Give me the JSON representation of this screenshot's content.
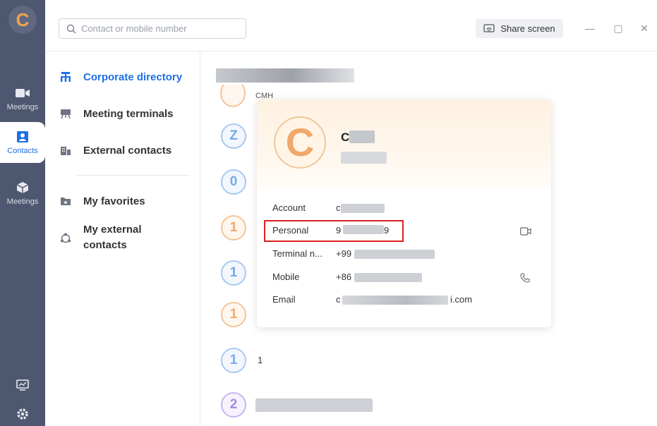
{
  "rail": {
    "logo_glyph": "C",
    "items": [
      {
        "label": "Meetings",
        "icon": "video-icon"
      },
      {
        "label": "Contacts",
        "icon": "contacts-icon"
      },
      {
        "label": "Meetings",
        "icon": "cube-icon"
      }
    ],
    "bottom": [
      {
        "icon": "screen-share-icon"
      },
      {
        "icon": "settings-icon"
      }
    ]
  },
  "search": {
    "placeholder": "Contact or mobile number"
  },
  "toolbar": {
    "share_label": "Share screen"
  },
  "window": {
    "minimize": "—",
    "maximize": "▢",
    "close": "✕"
  },
  "nav": {
    "items": [
      {
        "label": "Corporate directory",
        "active": true
      },
      {
        "label": "Meeting terminals"
      },
      {
        "label": "External contacts"
      },
      {
        "label": "My favorites"
      },
      {
        "label": "My external",
        "label2": "contacts"
      }
    ]
  },
  "list": {
    "partial_top": "CMH",
    "avatars": [
      "Z",
      "0",
      "1",
      "1",
      "1",
      "1",
      "2"
    ],
    "row_text": "1"
  },
  "card": {
    "logo_glyph": "C",
    "name": "C",
    "fields": [
      {
        "label": "Account",
        "value": "c"
      },
      {
        "label": "Personal",
        "value": "9",
        "value_end": "9"
      },
      {
        "label": "Terminal n...",
        "value": "+99"
      },
      {
        "label": "Mobile",
        "value": "+86"
      },
      {
        "label": "Email",
        "value": "c",
        "value_end": "i.com"
      }
    ]
  },
  "colors": {
    "rail": "#4d5770",
    "accent": "#1f6fe5",
    "highlight": "#e02020",
    "brand_orange": "#f0a86b"
  }
}
